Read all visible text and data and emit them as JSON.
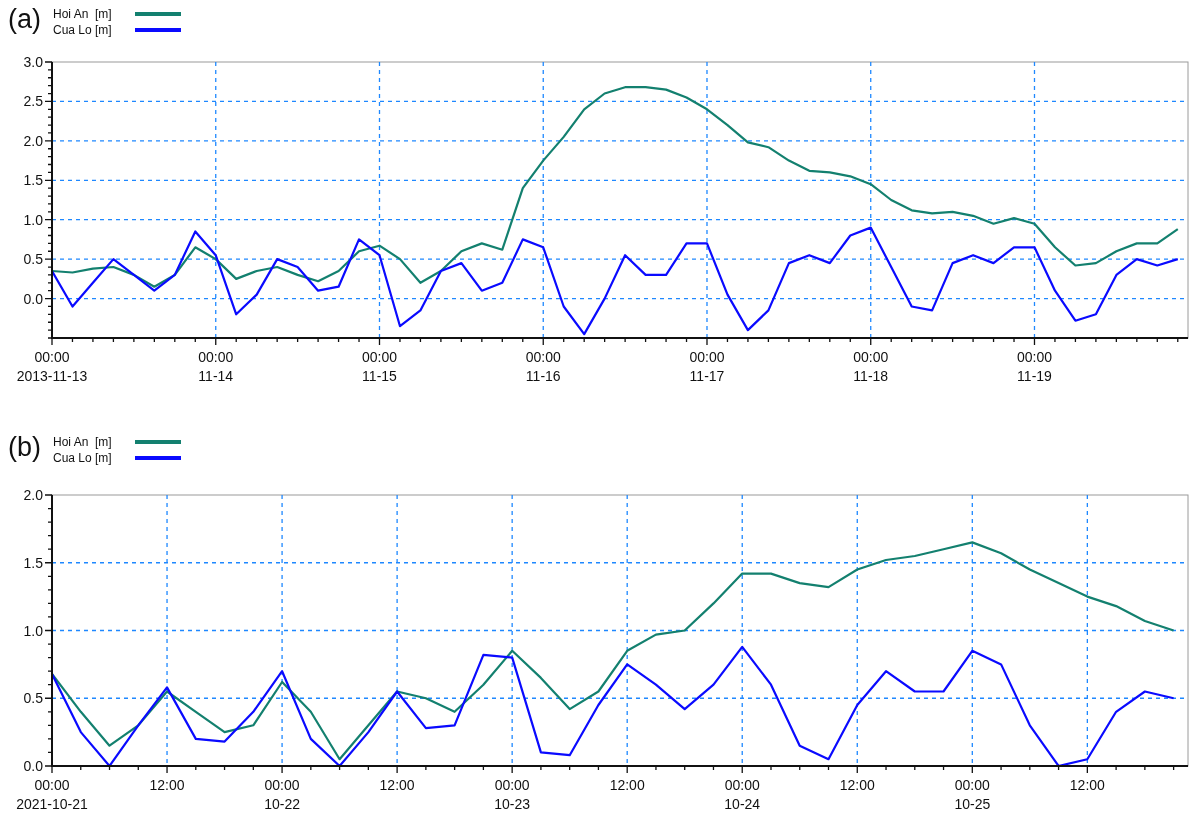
{
  "panels": [
    {
      "panel_label": "(a)",
      "chart_data": {
        "type": "line",
        "grid": true,
        "ylim": [
          -0.5,
          3
        ],
        "categories": [
          "00:00\n2013-11-13",
          null,
          null,
          null,
          null,
          null,
          null,
          null,
          "00:00\n11-14",
          null,
          null,
          null,
          null,
          null,
          null,
          null,
          "00:00\n11-15",
          null,
          null,
          null,
          null,
          null,
          null,
          null,
          "00:00\n11-16",
          null,
          null,
          null,
          null,
          null,
          null,
          null,
          "00:00\n11-17",
          null,
          null,
          null,
          null,
          null,
          null,
          null,
          "00:00\n11-18",
          null,
          null,
          null,
          null,
          null,
          null,
          null,
          "00:00\n11-19",
          null,
          null,
          null,
          null,
          null,
          null,
          null
        ],
        "yticks": [
          {
            "value": 0,
            "label": "0.0"
          },
          {
            "value": 0.5,
            "label": "0.5"
          },
          {
            "value": 1,
            "label": "1.0"
          },
          {
            "value": 1.5,
            "label": "1.5"
          },
          {
            "value": 2,
            "label": "2.0"
          },
          {
            "value": 2.5,
            "label": "2.5"
          },
          {
            "value": 3,
            "label": "3.0"
          }
        ],
        "series": [
          {
            "name": "Hoi An  [m]",
            "color": "#13806f",
            "values": [
              0.35,
              0.33,
              0.38,
              0.4,
              0.3,
              0.15,
              0.3,
              0.65,
              0.5,
              0.25,
              0.35,
              0.4,
              0.3,
              0.22,
              0.35,
              0.6,
              0.67,
              0.5,
              0.2,
              0.35,
              0.6,
              0.7,
              0.62,
              1.4,
              1.75,
              2.05,
              2.4,
              2.6,
              2.68,
              2.68,
              2.65,
              2.55,
              2.4,
              2.2,
              1.98,
              1.92,
              1.75,
              1.62,
              1.6,
              1.55,
              1.45,
              1.25,
              1.12,
              1.08,
              1.1,
              1.05,
              0.95,
              1.02,
              0.95,
              0.65,
              0.42,
              0.45,
              0.6,
              0.7,
              0.7,
              0.88
            ]
          },
          {
            "name": "Cua Lo [m]",
            "color": "#0a0aff",
            "values": [
              0.35,
              -0.1,
              0.2,
              0.5,
              0.3,
              0.1,
              0.3,
              0.85,
              0.55,
              -0.2,
              0.05,
              0.5,
              0.4,
              0.1,
              0.15,
              0.75,
              0.55,
              -0.35,
              -0.15,
              0.35,
              0.45,
              0.1,
              0.2,
              0.75,
              0.65,
              -0.1,
              -0.45,
              0.0,
              0.55,
              0.3,
              0.3,
              0.7,
              0.7,
              0.05,
              -0.4,
              -0.15,
              0.45,
              0.55,
              0.45,
              0.8,
              0.9,
              0.4,
              -0.1,
              -0.15,
              0.45,
              0.55,
              0.45,
              0.65,
              0.65,
              0.1,
              -0.28,
              -0.2,
              0.3,
              0.5,
              0.42,
              0.5
            ]
          }
        ]
      }
    },
    {
      "panel_label": "(b)",
      "chart_data": {
        "type": "line",
        "grid": true,
        "ylim": [
          0,
          2
        ],
        "categories": [
          "00:00\n2021-10-21",
          null,
          null,
          null,
          "12:00",
          null,
          null,
          null,
          "00:00\n10-22",
          null,
          null,
          null,
          "12:00",
          null,
          null,
          null,
          "00:00\n10-23",
          null,
          null,
          null,
          "12:00",
          null,
          null,
          null,
          "00:00\n10-24",
          null,
          null,
          null,
          "12:00",
          null,
          null,
          null,
          "00:00\n10-25",
          null,
          null,
          null,
          "12:00",
          null,
          null,
          null
        ],
        "yticks": [
          {
            "value": 0,
            "label": "0.0"
          },
          {
            "value": 0.5,
            "label": "0.5"
          },
          {
            "value": 1,
            "label": "1.0"
          },
          {
            "value": 1.5,
            "label": "1.5"
          },
          {
            "value": 2,
            "label": "2.0"
          }
        ],
        "series": [
          {
            "name": "Hoi An  [m]",
            "color": "#13806f",
            "values": [
              0.68,
              0.4,
              0.15,
              0.3,
              0.55,
              0.4,
              0.25,
              0.3,
              0.62,
              0.4,
              0.05,
              0.3,
              0.55,
              0.5,
              0.4,
              0.6,
              0.85,
              0.65,
              0.42,
              0.55,
              0.85,
              0.97,
              1.0,
              1.2,
              1.42,
              1.42,
              1.35,
              1.32,
              1.45,
              1.52,
              1.55,
              1.6,
              1.65,
              1.57,
              1.45,
              1.35,
              1.25,
              1.18,
              1.07,
              1.0
            ]
          },
          {
            "name": "Cua Lo [m]",
            "color": "#0a0aff",
            "values": [
              0.68,
              0.25,
              0.0,
              0.3,
              0.58,
              0.2,
              0.18,
              0.4,
              0.7,
              0.2,
              0.0,
              0.25,
              0.55,
              0.28,
              0.3,
              0.82,
              0.8,
              0.1,
              0.08,
              0.45,
              0.75,
              0.6,
              0.42,
              0.6,
              0.88,
              0.6,
              0.15,
              0.05,
              0.45,
              0.7,
              0.55,
              0.55,
              0.85,
              0.75,
              0.3,
              0.0,
              0.05,
              0.4,
              0.55,
              0.5
            ]
          }
        ]
      }
    }
  ]
}
